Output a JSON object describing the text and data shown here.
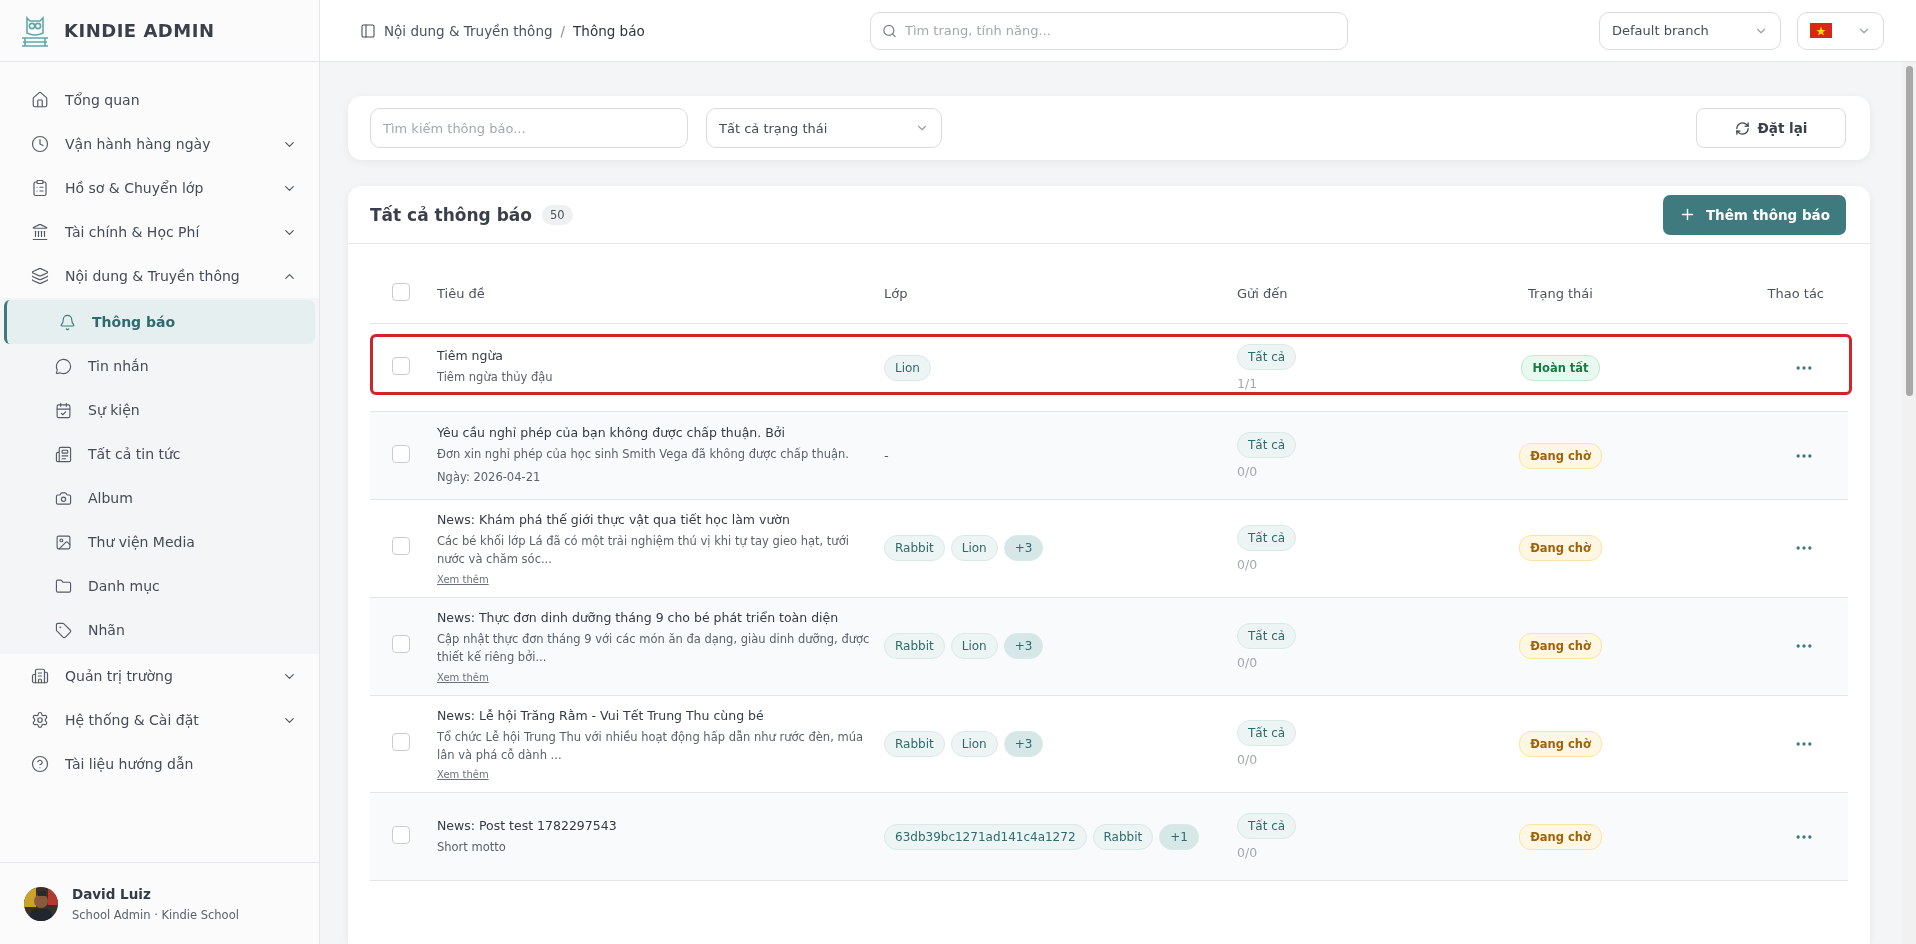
{
  "brand": {
    "name": "KINDIE ADMIN"
  },
  "sidebar": {
    "items": [
      {
        "label": "Tổng quan",
        "kind": "link"
      },
      {
        "label": "Vận hành hàng ngày",
        "kind": "group",
        "expanded": false
      },
      {
        "label": "Hồ sơ & Chuyển lớp",
        "kind": "group",
        "expanded": false
      },
      {
        "label": "Tài chính & Học Phí",
        "kind": "group",
        "expanded": false
      },
      {
        "label": "Nội dung & Truyền thông",
        "kind": "group",
        "expanded": true,
        "children": [
          {
            "label": "Thông báo",
            "selected": true
          },
          {
            "label": "Tin nhắn",
            "selected": false
          },
          {
            "label": "Sự kiện",
            "selected": false
          },
          {
            "label": "Tất cả tin tức",
            "selected": false
          },
          {
            "label": "Album",
            "selected": false
          },
          {
            "label": "Thư viện Media",
            "selected": false
          },
          {
            "label": "Danh mục",
            "selected": false
          },
          {
            "label": "Nhãn",
            "selected": false
          }
        ]
      },
      {
        "label": "Quản trị trường",
        "kind": "group",
        "expanded": false
      },
      {
        "label": "Hệ thống & Cài đặt",
        "kind": "group",
        "expanded": false
      },
      {
        "label": "Tài liệu hướng dẫn",
        "kind": "link"
      }
    ],
    "user": {
      "name": "David Luiz",
      "role": "School Admin · Kindie School"
    }
  },
  "header": {
    "breadcrumb": [
      "Nội dung & Truyền thông",
      "Thông báo"
    ],
    "separator": "/",
    "search": {
      "placeholder": "Tìm trang, tính năng..."
    },
    "branch": {
      "value": "Default branch"
    }
  },
  "filters": {
    "search": {
      "placeholder": "Tìm kiếm thông báo..."
    },
    "status": {
      "value": "Tất cả trạng thái"
    },
    "reset_button": "Đặt lại"
  },
  "card": {
    "title": "Tất cả thông báo",
    "count": "50",
    "add_button": "Thêm thông báo"
  },
  "table": {
    "select_all_checked": false,
    "columns": [
      "Tiêu đề",
      "Lớp",
      "Gửi đến",
      "Trạng thái",
      "Thao tác"
    ],
    "rows": [
      {
        "checked": false,
        "highlighted": true,
        "title": "Tiêm ngừa",
        "description_lines": [
          "Tiêm ngừa thủy đậu"
        ],
        "classes": [
          {
            "label": "Lion",
            "kind": "class"
          }
        ],
        "target": "Tất cả",
        "ratio": "1/1",
        "status": {
          "label": "Hoàn tất",
          "kind": "done"
        }
      },
      {
        "checked": false,
        "highlighted": false,
        "title": "Yêu cầu nghỉ phép của bạn không được chấp thuận. Bởi",
        "description_lines": [
          "Đơn xin nghỉ phép của học sinh Smith Vega đã không được chấp thuận.",
          "Ngày: 2026-04-21"
        ],
        "class_placeholder": "-",
        "target": "Tất cả",
        "ratio": "0/0",
        "status": {
          "label": "Đang chờ",
          "kind": "pending"
        }
      },
      {
        "checked": false,
        "highlighted": false,
        "title": "News: Khám phá thế giới thực vật qua tiết học làm vườn",
        "description_lines": [
          "Các bé khối lớp Lá đã có một trải nghiệm thú vị khi tự tay gieo hạt, tưới nước và chăm sóc..."
        ],
        "more_link": "Xem thêm",
        "classes": [
          {
            "label": "Rabbit",
            "kind": "class"
          },
          {
            "label": "Lion",
            "kind": "class"
          },
          {
            "label": "+3",
            "kind": "more"
          }
        ],
        "target": "Tất cả",
        "ratio": "0/0",
        "status": {
          "label": "Đang chờ",
          "kind": "pending"
        }
      },
      {
        "checked": false,
        "highlighted": false,
        "title": "News: Thực đơn dinh dưỡng tháng 9 cho bé phát triển toàn diện",
        "description_lines": [
          "Cập nhật thực đơn tháng 9 với các món ăn đa dạng, giàu dinh dưỡng, được thiết kế riêng bởi..."
        ],
        "more_link": "Xem thêm",
        "classes": [
          {
            "label": "Rabbit",
            "kind": "class"
          },
          {
            "label": "Lion",
            "kind": "class"
          },
          {
            "label": "+3",
            "kind": "more"
          }
        ],
        "target": "Tất cả",
        "ratio": "0/0",
        "status": {
          "label": "Đang chờ",
          "kind": "pending"
        }
      },
      {
        "checked": false,
        "highlighted": false,
        "title": "News: Lễ hội Trăng Rằm - Vui Tết Trung Thu cùng bé",
        "description_lines": [
          "Tổ chức Lễ hội Trung Thu với nhiều hoạt động hấp dẫn như rước đèn, múa lân và phá cỗ dành ..."
        ],
        "more_link": "Xem thêm",
        "classes": [
          {
            "label": "Rabbit",
            "kind": "class"
          },
          {
            "label": "Lion",
            "kind": "class"
          },
          {
            "label": "+3",
            "kind": "more"
          }
        ],
        "target": "Tất cả",
        "ratio": "0/0",
        "status": {
          "label": "Đang chờ",
          "kind": "pending"
        }
      },
      {
        "checked": false,
        "highlighted": false,
        "title": "News: Post test 1782297543",
        "description_lines": [
          "Short motto"
        ],
        "classes": [
          {
            "label": "63db39bc1271ad141c4a1272",
            "kind": "class"
          },
          {
            "label": "Rabbit",
            "kind": "class"
          },
          {
            "label": "+1",
            "kind": "more"
          }
        ],
        "target": "Tất cả",
        "ratio": "0/0",
        "status": {
          "label": "Đang chờ",
          "kind": "pending"
        }
      }
    ]
  }
}
